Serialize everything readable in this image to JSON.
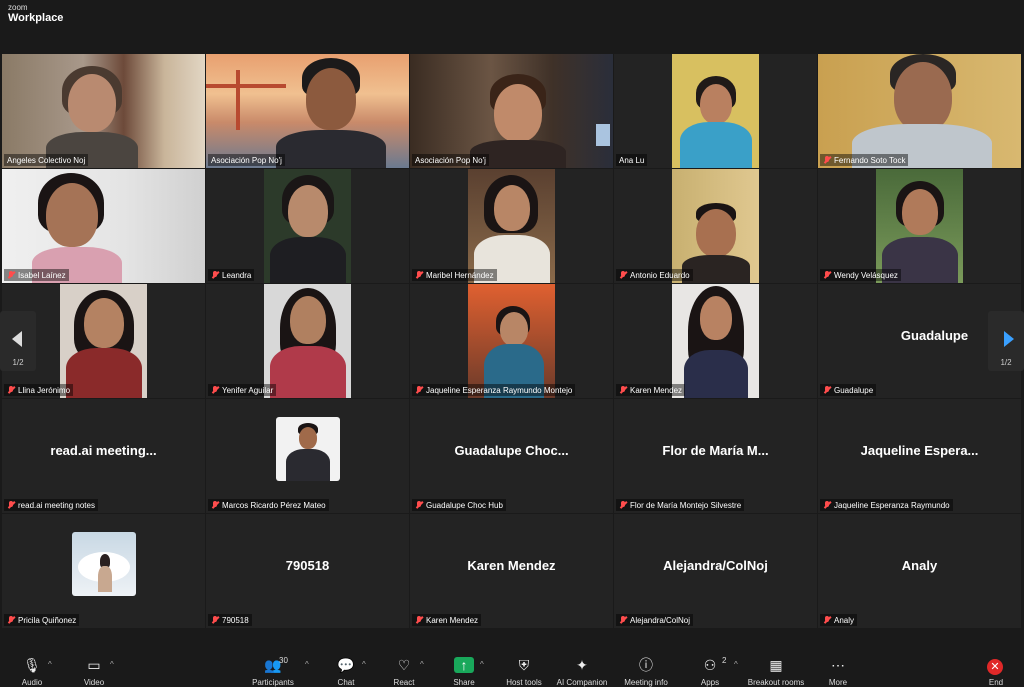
{
  "app": {
    "brand_top": "zoom",
    "brand_bottom": "Workplace"
  },
  "grid": {
    "page_left": "1/2",
    "page_right": "1/2",
    "tiles": [
      {
        "name": "Angeles  Colectivo Noj",
        "muted": false
      },
      {
        "name": "Asociación Pop No'j",
        "muted": false,
        "active": true
      },
      {
        "name": "Asociación Pop No'j",
        "muted": false
      },
      {
        "name": "Ana Lu",
        "muted": false
      },
      {
        "name": "Fernando Soto Tock",
        "muted": true
      },
      {
        "name": "Isabel Laínez",
        "muted": true
      },
      {
        "name": "Leandra",
        "muted": true
      },
      {
        "name": "Maribel Hernández",
        "muted": true
      },
      {
        "name": "Antonio Eduardo",
        "muted": true
      },
      {
        "name": "Wendy Velásquez",
        "muted": true
      },
      {
        "name": "Llina Jerónimo",
        "muted": true
      },
      {
        "name": "Yenifer Aguilar",
        "muted": true
      },
      {
        "name": "Jaqueline Esperanza Raymundo Montejo",
        "muted": true
      },
      {
        "name": "Karen Mendez",
        "muted": true
      },
      {
        "name": "Guadalupe",
        "muted": true,
        "display": "Guadalupe"
      },
      {
        "name": "read.ai meeting notes",
        "muted": true,
        "display": "read.ai meeting..."
      },
      {
        "name": "Marcos Ricardo Pérez Mateo",
        "muted": true
      },
      {
        "name": "Guadalupe Choc Hub",
        "muted": true,
        "display": "Guadalupe  Choc..."
      },
      {
        "name": "Flor de María Montejo Silvestre",
        "muted": true,
        "display": "Flor de María M..."
      },
      {
        "name": "Jaqueline Esperanza Raymundo",
        "muted": true,
        "display": "Jaqueline  Espera..."
      },
      {
        "name": "Pricila Quiñonez",
        "muted": true
      },
      {
        "name": "790518",
        "muted": true,
        "display": "790518"
      },
      {
        "name": "Karen Mendez",
        "muted": true,
        "display": "Karen Mendez"
      },
      {
        "name": "Alejandra/ColNoj",
        "muted": true,
        "display": "Alejandra/ColNoj"
      },
      {
        "name": "Analy",
        "muted": true,
        "display": "Analy"
      }
    ]
  },
  "toolbar": {
    "audio": "Audio",
    "video": "Video",
    "participants": "Participants",
    "participants_count": "30",
    "chat": "Chat",
    "react": "React",
    "share": "Share",
    "host_tools": "Host tools",
    "ai_companion": "AI Companion",
    "meeting_info": "Meeting info",
    "apps": "Apps",
    "apps_count": "2",
    "breakout": "Breakout rooms",
    "more": "More",
    "end": "End"
  },
  "colors": {
    "active_speaker": "#2ecc71",
    "share": "#19a85b",
    "end": "#e02828",
    "muted": "#ff4d4d"
  }
}
